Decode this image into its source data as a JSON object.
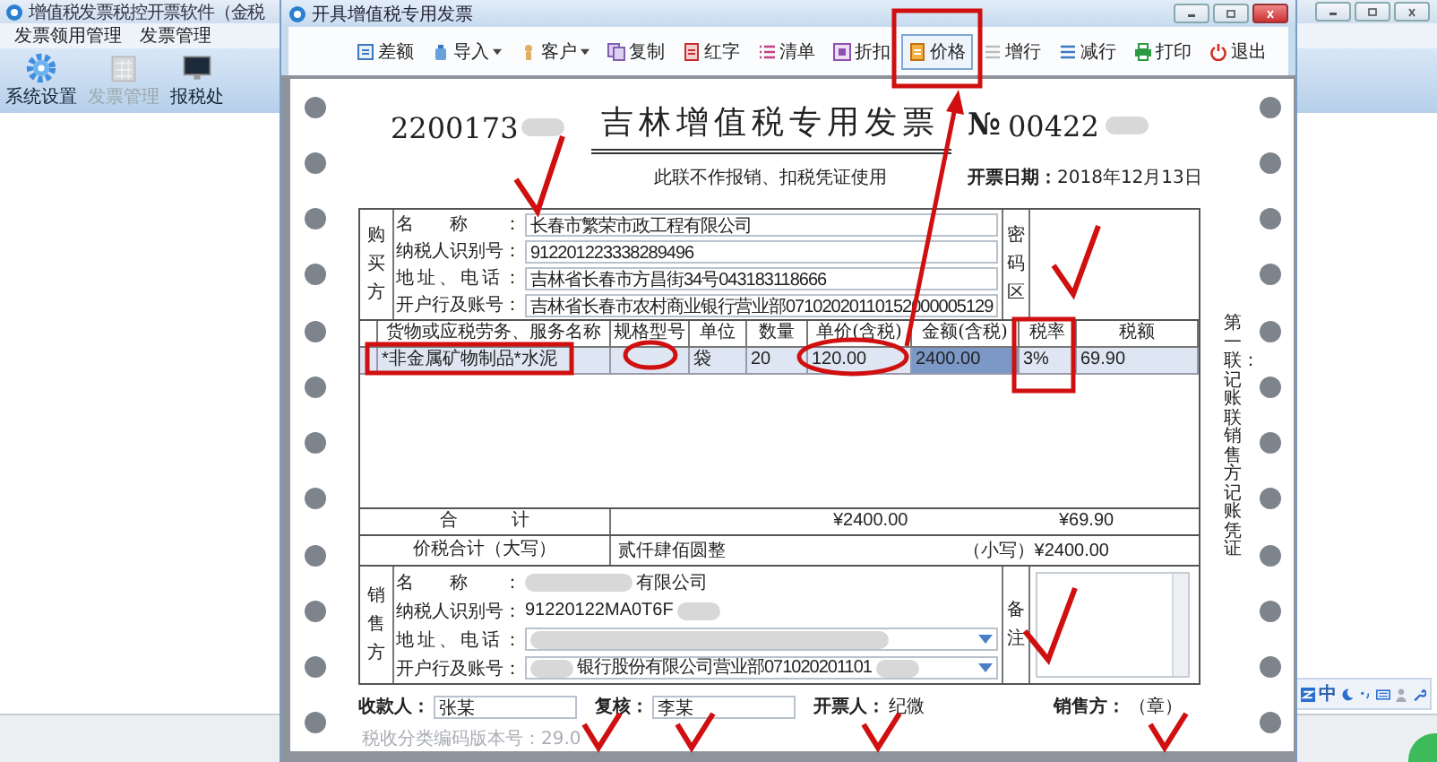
{
  "background_app": {
    "title": "增值税发票税控开票软件（金税",
    "menus": [
      "发票领用管理",
      "发票管理"
    ],
    "tools": [
      {
        "label": "系统设置",
        "disabled": false
      },
      {
        "label": "发票管理",
        "disabled": true
      },
      {
        "label": "报税处",
        "disabled": false
      }
    ],
    "ime_label": "中"
  },
  "dialog": {
    "title": "开具增值税专用发票",
    "toolbar": [
      {
        "label": "差额",
        "kind": "button",
        "selected": false
      },
      {
        "label": "导入",
        "kind": "menu",
        "selected": false
      },
      {
        "label": "客户",
        "kind": "menu",
        "selected": false
      },
      {
        "label": "复制",
        "kind": "button",
        "selected": false
      },
      {
        "label": "红字",
        "kind": "button",
        "selected": false
      },
      {
        "label": "清单",
        "kind": "button",
        "selected": false
      },
      {
        "label": "折扣",
        "kind": "button",
        "selected": false
      },
      {
        "label": "价格",
        "kind": "button",
        "selected": true
      },
      {
        "label": "增行",
        "kind": "button",
        "selected": false
      },
      {
        "label": "减行",
        "kind": "button",
        "selected": false
      },
      {
        "label": "打印",
        "kind": "button",
        "selected": false
      },
      {
        "label": "退出",
        "kind": "button",
        "selected": false
      }
    ]
  },
  "invoice": {
    "code": "2200173",
    "title": "吉林增值税专用发票",
    "number_sign": "№",
    "number": "00422",
    "notice": "此联不作报销、扣税凭证使用",
    "date_label": "开票日期：",
    "date": "2018年12月13日",
    "buyer": {
      "section_label": "购买方",
      "fields": [
        {
          "label": "名称：",
          "value": "长春市繁荣市政工程有限公司"
        },
        {
          "label": "纳税人识别号：",
          "value": "912201223338289496"
        },
        {
          "label": "地址、电话：",
          "value": "吉林省长春市方昌街34号043183118666"
        },
        {
          "label": "开户行及账号：",
          "value": "吉林省长春市农村商业银行营业部07102020110152000005129"
        }
      ]
    },
    "password_label": "密码区",
    "columns": [
      "货物或应税劳务、服务名称",
      "规格型号",
      "单位",
      "数量",
      "单价(含税)",
      "金额(含税)",
      "税率",
      "税额"
    ],
    "rows": [
      {
        "cells": [
          {
            "text": "*非金属矿物制品*水泥",
            "selected": false
          },
          {
            "selected": false
          },
          {
            "text": "袋",
            "selected": false
          },
          {
            "text": "20",
            "selected": false
          },
          {
            "text": "120.00",
            "selected": false
          },
          {
            "text": "2400.00",
            "selected": true
          },
          {
            "text": "3%",
            "selected": false
          },
          {
            "text": "69.90",
            "selected": false
          }
        ]
      }
    ],
    "total": {
      "label": "合计",
      "amount": "¥2400.00",
      "tax": "¥69.90"
    },
    "grand_total": {
      "label": "价税合计（大写）",
      "words": "贰仟肆佰圆整",
      "small_label": "（小写）",
      "small": "¥2400.00"
    },
    "seller": {
      "section_label": "销售方",
      "fields": [
        {
          "label": "名称：",
          "kind": "text",
          "redacted_before": true,
          "redacted_after": false,
          "value": "有限公司"
        },
        {
          "label": "纳税人识别号：",
          "kind": "text",
          "redacted_before": false,
          "redacted_after": true,
          "value": "91220122MA0T6F"
        },
        {
          "label": "地址、电话：",
          "kind": "dropdown",
          "redacted_before": true,
          "redacted_after": false
        },
        {
          "label": "开户行及账号：",
          "kind": "dropdown",
          "redacted_before": true,
          "redacted_after": true,
          "value": "银行股份有限公司营业部071020201101"
        }
      ]
    },
    "remarks_label": "备注",
    "side_note": "第一联：记账联销售方记账凭证",
    "signatures": [
      {
        "label": "收款人：",
        "kind": "field",
        "value": "张某"
      },
      {
        "label": "复核：",
        "kind": "field",
        "value": "李某"
      },
      {
        "label": "开票人：",
        "kind": "text",
        "value": "纪微"
      },
      {
        "label": "销售方：",
        "kind": "text",
        "value": "（章）"
      }
    ],
    "version": "税收分类编码版本号：29.0"
  }
}
